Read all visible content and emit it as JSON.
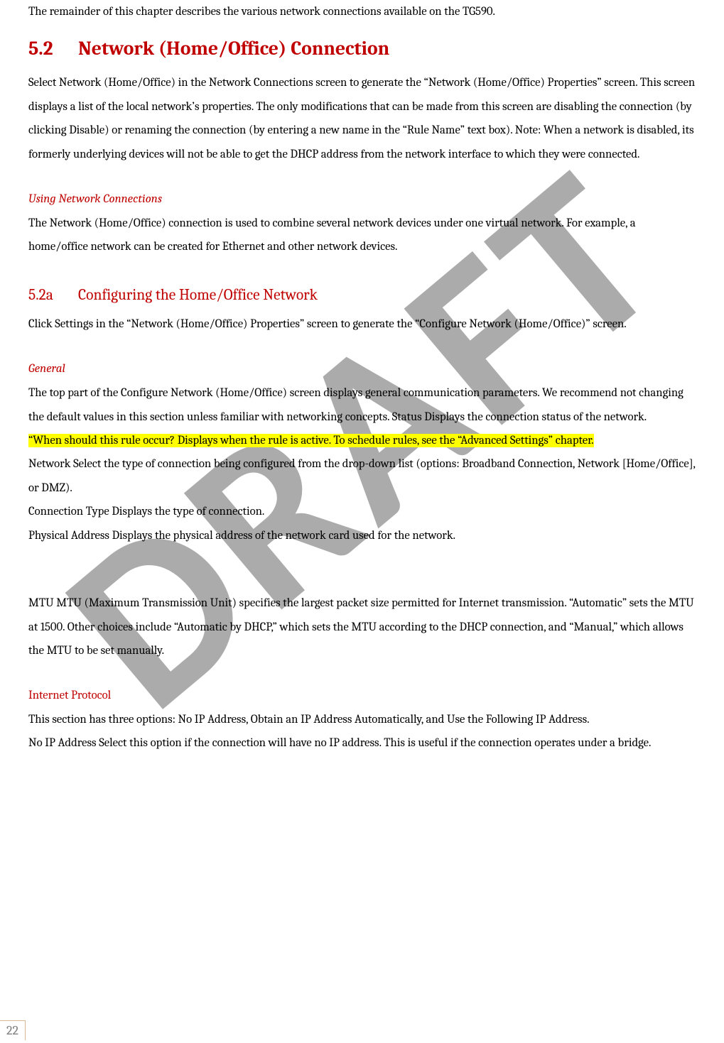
{
  "intro": "The remainder of this chapter describes the various network connections available on the TG590.",
  "h2": {
    "num": "5.2",
    "title": "Network (Home/Office) Connection"
  },
  "para52": "Select Network (Home/Office) in the Network Connections screen to generate the “Network (Home/Office) Properties” screen. This screen displays a list of the local network’s properties. The only modifications that can be made from this screen are disabling the connection (by clicking Disable) or renaming the connection (by entering a new name in the “Rule Name” text box). Note: When a network is disabled, its formerly underlying devices will not be able to get the DHCP address from the network interface to which they were connected.",
  "usingNet": {
    "heading": "Using Network Connections",
    "body": "The Network (Home/Office) connection is used to combine several network devices under one virtual network. For example, a home/office network can be created for Ethernet and other network devices."
  },
  "h3": {
    "num": "5.2a",
    "title": "Configuring the Home/Office Network"
  },
  "para52a": "Click Settings in the “Network (Home/Office) Properties” screen to generate the “Configure Network (Home/Office)” screen.",
  "general": {
    "heading": "General",
    "l1": "The top part of the Configure Network (Home/Office) screen displays general communication parameters. We recommend not changing the default values in this section unless familiar with networking concepts. Status Displays the connection status of the network.",
    "hl": "“When should this rule occur? Displays when the rule is active. To schedule rules, see the “Advanced Settings” chapter.",
    "l2a": "Network Select the type of connection being configured from the drop-down list (options: Broadband Connection, Network [Home/Office], or DMZ).",
    "l2b": "Connection Type Displays the type of connection.",
    "l2c": "Physical Address Displays the physical address of the network card used for the network.",
    "mtu": "MTU MTU (Maximum Transmission Unit) specifies the largest packet size permitted for Internet transmission. “Automatic” sets the MTU at 1500. Other choices include “Automatic by DHCP,” which sets the MTU according to the DHCP connection, and “Manual,” which allows the MTU to be set manually."
  },
  "ip": {
    "heading": "Internet Protocol",
    "l1": "This section has three options: No IP Address, Obtain an IP Address Automatically, and Use the Following IP Address.",
    "l2": "No IP Address Select this option if the connection will have no IP address. This is useful if the connection operates under a bridge."
  },
  "watermark": "DRAFT",
  "pageNum": "22"
}
